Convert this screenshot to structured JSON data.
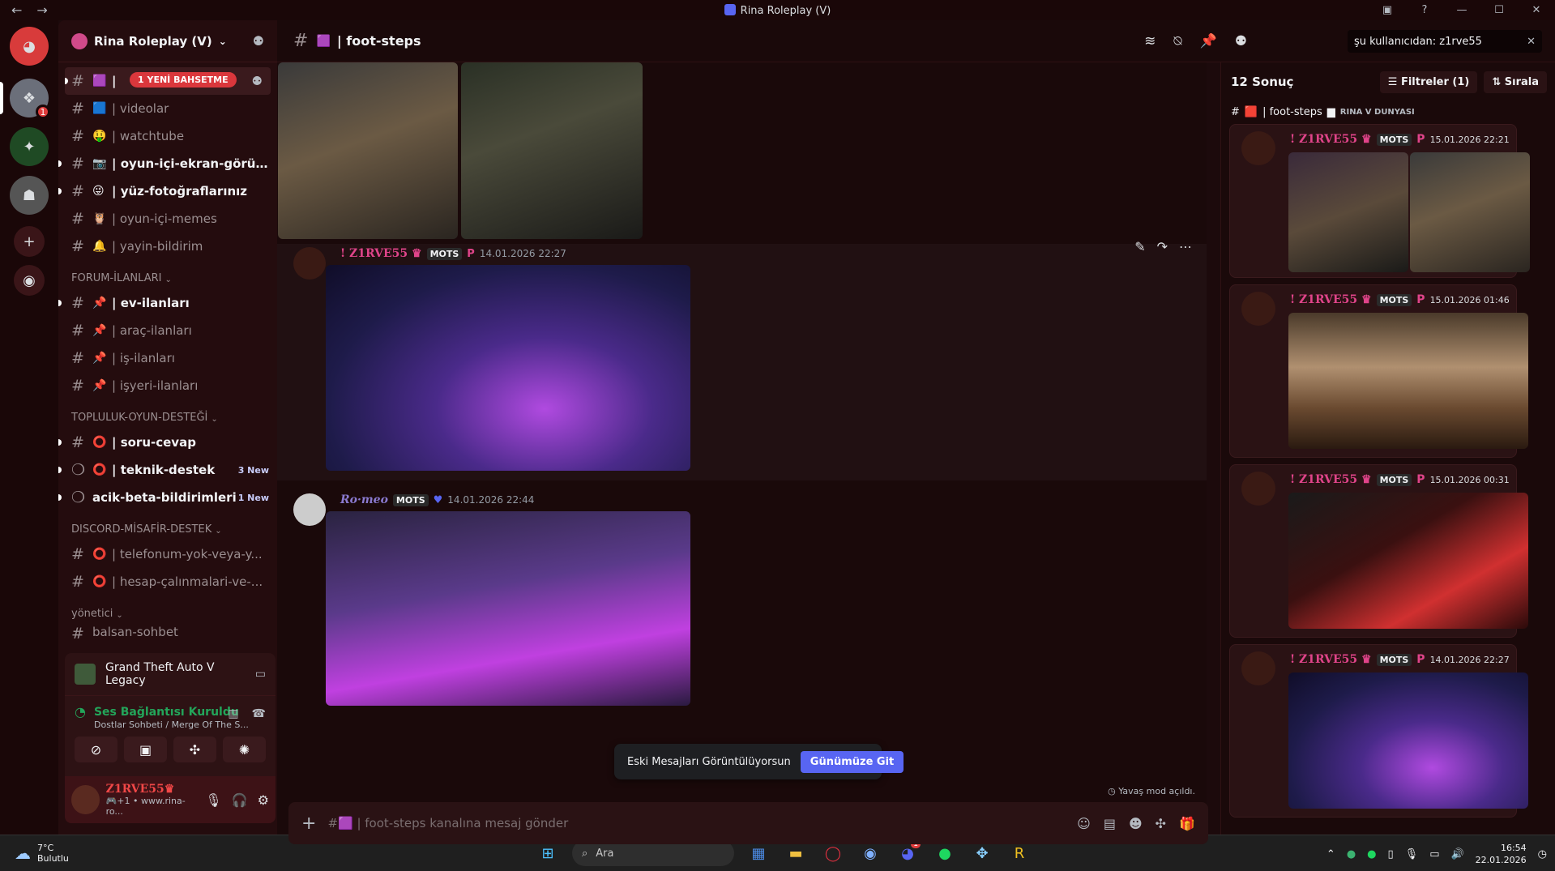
{
  "window": {
    "title": "Rina Roleplay (V)",
    "back": "←",
    "forward": "→"
  },
  "server": {
    "name": "Rina Roleplay (V)",
    "chevron": "⌄"
  },
  "guilds": [
    {
      "badge": "1"
    }
  ],
  "channels_top": [
    {
      "emoji": "🟪",
      "name": "|",
      "mention": "1 YENİ BAHSETME"
    },
    {
      "emoji": "🟦",
      "name": "| videolar"
    },
    {
      "emoji": "🤑",
      "name": "| watchtube"
    },
    {
      "emoji": "📷",
      "name": "| oyun-içi-ekran-görünt..."
    },
    {
      "emoji": "😜",
      "name": "| yüz-fotoğraflarınız"
    },
    {
      "emoji": "🦉",
      "name": "| oyun-içi-memes"
    },
    {
      "emoji": "🔔",
      "name": "| yayin-bildirim"
    }
  ],
  "categories": {
    "forum": "FORUM-İLANLARI",
    "topluluk": "TOPLULUK-OYUN-DESTEĞİ",
    "misafir": "DISCORD-MİSAFİR-DESTEK",
    "yonetici": "yönetici"
  },
  "channels_forum": [
    {
      "emoji": "📌",
      "name": "| ev-ilanları"
    },
    {
      "emoji": "📌",
      "name": "| araç-ilanları"
    },
    {
      "emoji": "📌",
      "name": "| iş-ilanları"
    },
    {
      "emoji": "📌",
      "name": "| işyeri-ilanları"
    }
  ],
  "channels_topluluk": [
    {
      "emoji": "⭕",
      "name": "| soru-cevap",
      "new": ""
    },
    {
      "emoji": "⭕",
      "name": "| teknik-destek",
      "new": "3 New"
    },
    {
      "emoji": "",
      "name": "acik-beta-bildirimleri",
      "new": "1 New"
    }
  ],
  "channels_misafir": [
    {
      "emoji": "⭕",
      "name": "| telefonum-yok-veya-y..."
    },
    {
      "emoji": "⭕",
      "name": "| hesap-çalınmalari-ve-..."
    }
  ],
  "channel_partial": "balsan-sohbet",
  "activity": {
    "game": "Grand Theft Auto V Legacy"
  },
  "voice": {
    "status": "Ses Bağlantısı Kuruldu",
    "channel": "Dostlar Sohbeti / Merge Of The S..."
  },
  "user": {
    "name": "Z1RVE55♛",
    "status": "🎮+1 • www.rina-ro..."
  },
  "header": {
    "channel": "| foot-steps",
    "search": "şu kullanıcıdan: z1rve55"
  },
  "messages": [
    {
      "author": "! Z1RVE55 ♛",
      "tag": "MOTS",
      "time": "14.01.2026 22:27",
      "color": "#e0448a"
    },
    {
      "author": "Ro·meo",
      "tag": "MOTS",
      "time": "14.01.2026 22:44",
      "color": "#8a7ad0"
    }
  ],
  "old_messages": {
    "text": "Eski Mesajları Görüntülüyorsun",
    "button": "Günümüze Git"
  },
  "slow_mode": "Yavaş mod açıldı.",
  "composer": {
    "placeholder": "#🟪 | foot-steps kanalına mesaj gönder"
  },
  "results": {
    "count": "12 Sonuç",
    "filters": "Filtreler (1)",
    "sort": "Sırala",
    "channel": "| foot-steps",
    "server": "RINA V DUNYASI",
    "items": [
      {
        "author": "! Z1RVE55 ♛",
        "tag": "MOTS",
        "time": "15.01.2026 22:21"
      },
      {
        "author": "! Z1RVE55 ♛",
        "tag": "MOTS",
        "time": "15.01.2026 01:46"
      },
      {
        "author": "! Z1RVE55 ♛",
        "tag": "MOTS",
        "time": "15.01.2026 00:31"
      },
      {
        "author": "! Z1RVE55 ♛",
        "tag": "MOTS",
        "time": "14.01.2026 22:27"
      }
    ]
  },
  "taskbar": {
    "temp": "7°C",
    "weather": "Bulutlu",
    "search": "Ara",
    "discord_badge": "1",
    "time": "16:54",
    "date": "22.01.2026"
  }
}
